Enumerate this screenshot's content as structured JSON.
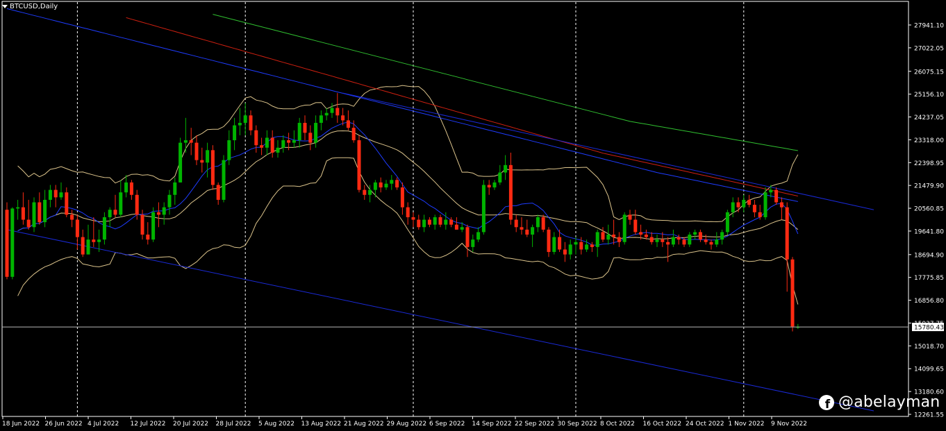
{
  "header": {
    "symbol_label": "BTCUSD,Daily"
  },
  "watermark": {
    "handle": "@abelayman",
    "icon": "facebook-icon"
  },
  "colors": {
    "background": "#000000",
    "frame": "#ffffff",
    "candle_up": "#00b400",
    "candle_down": "#ff2a12",
    "ma_fast": "#1e3cff",
    "ma_slow_red": "#d02010",
    "ma_slow_green": "#30c030",
    "band": "#dcc48c",
    "trendline": "#1a2ad8",
    "price_line": "#b8b8b8"
  },
  "chart_data": {
    "type": "candlestick",
    "y_ticks": [
      "27941.10",
      "27022.05",
      "26075.15",
      "25156.10",
      "24237.05",
      "23318.00",
      "22398.95",
      "21479.90",
      "20560.85",
      "19641.80",
      "18694.90",
      "17775.85",
      "16856.80",
      "15937.75",
      "15018.70",
      "14099.65",
      "13180.60",
      "12261.55"
    ],
    "ylim": [
      12261.55,
      28700
    ],
    "current_price": "15780.43",
    "x_labels": [
      "18 Jun 2022",
      "26 Jun 2022",
      "4 Jul 2022",
      "12 Jul 2022",
      "20 Jul 2022",
      "28 Jul 2022",
      "5 Aug 2022",
      "13 Aug 2022",
      "21 Aug 2022",
      "29 Aug 2022",
      "6 Sep 2022",
      "14 Sep 2022",
      "22 Sep 2022",
      "30 Sep 2022",
      "8 Oct 2022",
      "16 Oct 2022",
      "24 Oct 2022",
      "1 Nov 2022",
      "9 Nov 2022"
    ],
    "day_count": 147,
    "separator_days": [
      13,
      44,
      75,
      105,
      136
    ],
    "candles": [
      {
        "o": 20500,
        "h": 20800,
        "l": 17700,
        "c": 17800
      },
      {
        "o": 17800,
        "h": 20600,
        "l": 17700,
        "c": 20550
      },
      {
        "o": 20550,
        "h": 20900,
        "l": 20100,
        "c": 20600
      },
      {
        "o": 20600,
        "h": 21200,
        "l": 19900,
        "c": 20100
      },
      {
        "o": 20100,
        "h": 20900,
        "l": 19700,
        "c": 19800
      },
      {
        "o": 19800,
        "h": 21000,
        "l": 19600,
        "c": 20800
      },
      {
        "o": 20800,
        "h": 21200,
        "l": 19900,
        "c": 20000
      },
      {
        "o": 20000,
        "h": 21300,
        "l": 19800,
        "c": 20900
      },
      {
        "o": 20900,
        "h": 21500,
        "l": 20600,
        "c": 21300
      },
      {
        "o": 21300,
        "h": 21500,
        "l": 20600,
        "c": 21000
      },
      {
        "o": 21000,
        "h": 21600,
        "l": 20900,
        "c": 21200
      },
      {
        "o": 21200,
        "h": 21400,
        "l": 20200,
        "c": 20300
      },
      {
        "o": 20300,
        "h": 20500,
        "l": 19800,
        "c": 20100
      },
      {
        "o": 20100,
        "h": 20300,
        "l": 18900,
        "c": 19400
      },
      {
        "o": 19400,
        "h": 19700,
        "l": 18600,
        "c": 18700
      },
      {
        "o": 18700,
        "h": 19900,
        "l": 18700,
        "c": 19300
      },
      {
        "o": 19300,
        "h": 20200,
        "l": 19000,
        "c": 19200
      },
      {
        "o": 19200,
        "h": 19700,
        "l": 18800,
        "c": 19300
      },
      {
        "o": 19300,
        "h": 20400,
        "l": 19100,
        "c": 20200
      },
      {
        "o": 20200,
        "h": 20600,
        "l": 19800,
        "c": 20500
      },
      {
        "o": 20500,
        "h": 21100,
        "l": 20200,
        "c": 20300
      },
      {
        "o": 20300,
        "h": 21700,
        "l": 20200,
        "c": 21200
      },
      {
        "o": 21200,
        "h": 21900,
        "l": 21000,
        "c": 21600
      },
      {
        "o": 21600,
        "h": 21700,
        "l": 20900,
        "c": 21100
      },
      {
        "o": 21100,
        "h": 21300,
        "l": 20100,
        "c": 20300
      },
      {
        "o": 20300,
        "h": 20500,
        "l": 19300,
        "c": 19500
      },
      {
        "o": 19500,
        "h": 20000,
        "l": 19100,
        "c": 19300
      },
      {
        "o": 19300,
        "h": 20600,
        "l": 19200,
        "c": 20400
      },
      {
        "o": 20400,
        "h": 20800,
        "l": 19800,
        "c": 20300
      },
      {
        "o": 20300,
        "h": 20800,
        "l": 19900,
        "c": 20600
      },
      {
        "o": 20600,
        "h": 21300,
        "l": 20300,
        "c": 21100
      },
      {
        "o": 21100,
        "h": 21800,
        "l": 20700,
        "c": 21600
      },
      {
        "o": 21600,
        "h": 23400,
        "l": 21600,
        "c": 23200
      },
      {
        "o": 23200,
        "h": 24200,
        "l": 22800,
        "c": 23300
      },
      {
        "o": 23300,
        "h": 23800,
        "l": 22700,
        "c": 23200
      },
      {
        "o": 23200,
        "h": 23500,
        "l": 22300,
        "c": 22500
      },
      {
        "o": 22500,
        "h": 23000,
        "l": 22000,
        "c": 22400
      },
      {
        "o": 22400,
        "h": 23200,
        "l": 21800,
        "c": 22900
      },
      {
        "o": 22900,
        "h": 23100,
        "l": 21300,
        "c": 21500
      },
      {
        "o": 21500,
        "h": 21600,
        "l": 20700,
        "c": 20900
      },
      {
        "o": 20900,
        "h": 22700,
        "l": 20800,
        "c": 22500
      },
      {
        "o": 22500,
        "h": 23700,
        "l": 22300,
        "c": 23300
      },
      {
        "o": 23300,
        "h": 24200,
        "l": 22900,
        "c": 23900
      },
      {
        "o": 23900,
        "h": 24600,
        "l": 23500,
        "c": 24000
      },
      {
        "o": 24000,
        "h": 24800,
        "l": 23500,
        "c": 24300
      },
      {
        "o": 24300,
        "h": 24500,
        "l": 23500,
        "c": 23700
      },
      {
        "o": 23700,
        "h": 23900,
        "l": 22800,
        "c": 23100
      },
      {
        "o": 23100,
        "h": 23400,
        "l": 22700,
        "c": 23000
      },
      {
        "o": 23000,
        "h": 23700,
        "l": 22700,
        "c": 23400
      },
      {
        "o": 23400,
        "h": 23700,
        "l": 22600,
        "c": 22800
      },
      {
        "o": 22800,
        "h": 23300,
        "l": 22600,
        "c": 23000
      },
      {
        "o": 23000,
        "h": 23500,
        "l": 22800,
        "c": 23300
      },
      {
        "o": 23300,
        "h": 23600,
        "l": 22900,
        "c": 23200
      },
      {
        "o": 23200,
        "h": 23700,
        "l": 23000,
        "c": 23300
      },
      {
        "o": 23300,
        "h": 24200,
        "l": 23000,
        "c": 24000
      },
      {
        "o": 24000,
        "h": 24300,
        "l": 23300,
        "c": 23600
      },
      {
        "o": 23600,
        "h": 23900,
        "l": 22900,
        "c": 23200
      },
      {
        "o": 23200,
        "h": 24300,
        "l": 23000,
        "c": 24000
      },
      {
        "o": 24000,
        "h": 24500,
        "l": 23700,
        "c": 24300
      },
      {
        "o": 24300,
        "h": 24600,
        "l": 24100,
        "c": 24400
      },
      {
        "o": 24400,
        "h": 24800,
        "l": 24200,
        "c": 24600
      },
      {
        "o": 24600,
        "h": 25200,
        "l": 24000,
        "c": 24300
      },
      {
        "o": 24300,
        "h": 24600,
        "l": 23900,
        "c": 24100
      },
      {
        "o": 24100,
        "h": 24500,
        "l": 23700,
        "c": 23800
      },
      {
        "o": 23800,
        "h": 24100,
        "l": 23200,
        "c": 23300
      },
      {
        "o": 23300,
        "h": 23500,
        "l": 21200,
        "c": 21300
      },
      {
        "o": 21300,
        "h": 21500,
        "l": 20900,
        "c": 21100
      },
      {
        "o": 21100,
        "h": 21500,
        "l": 20800,
        "c": 21300
      },
      {
        "o": 21300,
        "h": 21700,
        "l": 21000,
        "c": 21600
      },
      {
        "o": 21600,
        "h": 21800,
        "l": 21200,
        "c": 21400
      },
      {
        "o": 21400,
        "h": 21700,
        "l": 21300,
        "c": 21550
      },
      {
        "o": 21550,
        "h": 21900,
        "l": 21300,
        "c": 21700
      },
      {
        "o": 21700,
        "h": 21800,
        "l": 21300,
        "c": 21400
      },
      {
        "o": 21400,
        "h": 21600,
        "l": 20300,
        "c": 20600
      },
      {
        "o": 20600,
        "h": 20800,
        "l": 19900,
        "c": 20200
      },
      {
        "o": 20200,
        "h": 20400,
        "l": 19800,
        "c": 20100
      },
      {
        "o": 20100,
        "h": 20300,
        "l": 19700,
        "c": 19800
      },
      {
        "o": 19800,
        "h": 20300,
        "l": 19600,
        "c": 20100
      },
      {
        "o": 20100,
        "h": 20200,
        "l": 19800,
        "c": 19900
      },
      {
        "o": 19900,
        "h": 20300,
        "l": 19700,
        "c": 20200
      },
      {
        "o": 20200,
        "h": 20300,
        "l": 19800,
        "c": 19900
      },
      {
        "o": 19900,
        "h": 20400,
        "l": 19700,
        "c": 20100
      },
      {
        "o": 20100,
        "h": 20200,
        "l": 19800,
        "c": 19900
      },
      {
        "o": 19900,
        "h": 20200,
        "l": 19700,
        "c": 19700
      },
      {
        "o": 19700,
        "h": 20000,
        "l": 19600,
        "c": 19800
      },
      {
        "o": 19800,
        "h": 19900,
        "l": 18600,
        "c": 19000
      },
      {
        "o": 19000,
        "h": 19500,
        "l": 18800,
        "c": 19300
      },
      {
        "o": 19300,
        "h": 19800,
        "l": 19200,
        "c": 19600
      },
      {
        "o": 19600,
        "h": 21700,
        "l": 19500,
        "c": 21500
      },
      {
        "o": 21500,
        "h": 21700,
        "l": 21100,
        "c": 21400
      },
      {
        "o": 21400,
        "h": 21700,
        "l": 21300,
        "c": 21600
      },
      {
        "o": 21600,
        "h": 22300,
        "l": 21500,
        "c": 22000
      },
      {
        "o": 22000,
        "h": 22700,
        "l": 21700,
        "c": 22300
      },
      {
        "o": 22300,
        "h": 22800,
        "l": 19900,
        "c": 20100
      },
      {
        "o": 20100,
        "h": 20300,
        "l": 19600,
        "c": 19800
      },
      {
        "o": 19800,
        "h": 20200,
        "l": 19500,
        "c": 19700
      },
      {
        "o": 19700,
        "h": 20100,
        "l": 19400,
        "c": 19500
      },
      {
        "o": 19500,
        "h": 19900,
        "l": 19000,
        "c": 19800
      },
      {
        "o": 19800,
        "h": 20300,
        "l": 19600,
        "c": 20200
      },
      {
        "o": 20200,
        "h": 20300,
        "l": 19600,
        "c": 19700
      },
      {
        "o": 19700,
        "h": 19800,
        "l": 18600,
        "c": 18800
      },
      {
        "o": 18800,
        "h": 19600,
        "l": 18700,
        "c": 19400
      },
      {
        "o": 19400,
        "h": 19700,
        "l": 18800,
        "c": 18900
      },
      {
        "o": 18900,
        "h": 19200,
        "l": 18400,
        "c": 18700
      },
      {
        "o": 18700,
        "h": 19300,
        "l": 18500,
        "c": 19100
      },
      {
        "o": 19100,
        "h": 19400,
        "l": 18700,
        "c": 19200
      },
      {
        "o": 19200,
        "h": 19400,
        "l": 18700,
        "c": 18900
      },
      {
        "o": 18900,
        "h": 19300,
        "l": 18800,
        "c": 19100
      },
      {
        "o": 19100,
        "h": 19200,
        "l": 18800,
        "c": 19000
      },
      {
        "o": 19000,
        "h": 19700,
        "l": 18600,
        "c": 19600
      },
      {
        "o": 19600,
        "h": 19800,
        "l": 19200,
        "c": 19300
      },
      {
        "o": 19300,
        "h": 19900,
        "l": 19100,
        "c": 19500
      },
      {
        "o": 19500,
        "h": 20100,
        "l": 19100,
        "c": 19400
      },
      {
        "o": 19400,
        "h": 19600,
        "l": 19000,
        "c": 19200
      },
      {
        "o": 19200,
        "h": 20400,
        "l": 19100,
        "c": 20300
      },
      {
        "o": 20300,
        "h": 20500,
        "l": 19900,
        "c": 20100
      },
      {
        "o": 20100,
        "h": 20500,
        "l": 19500,
        "c": 19600
      },
      {
        "o": 19600,
        "h": 19900,
        "l": 19300,
        "c": 19500
      },
      {
        "o": 19500,
        "h": 19700,
        "l": 19300,
        "c": 19400
      },
      {
        "o": 19400,
        "h": 19600,
        "l": 19100,
        "c": 19200
      },
      {
        "o": 19200,
        "h": 19500,
        "l": 19000,
        "c": 19300
      },
      {
        "o": 19300,
        "h": 19600,
        "l": 19000,
        "c": 19200
      },
      {
        "o": 19200,
        "h": 19400,
        "l": 18400,
        "c": 19100
      },
      {
        "o": 19100,
        "h": 19700,
        "l": 19000,
        "c": 19400
      },
      {
        "o": 19400,
        "h": 19500,
        "l": 19100,
        "c": 19300
      },
      {
        "o": 19300,
        "h": 19400,
        "l": 19000,
        "c": 19100
      },
      {
        "o": 19100,
        "h": 19600,
        "l": 19000,
        "c": 19500
      },
      {
        "o": 19500,
        "h": 19700,
        "l": 19300,
        "c": 19600
      },
      {
        "o": 19600,
        "h": 19700,
        "l": 19200,
        "c": 19300
      },
      {
        "o": 19300,
        "h": 19500,
        "l": 19100,
        "c": 19200
      },
      {
        "o": 19200,
        "h": 19300,
        "l": 18900,
        "c": 19100
      },
      {
        "o": 19100,
        "h": 19600,
        "l": 19000,
        "c": 19300
      },
      {
        "o": 19300,
        "h": 19700,
        "l": 19100,
        "c": 19600
      },
      {
        "o": 19600,
        "h": 20500,
        "l": 19500,
        "c": 20400
      },
      {
        "o": 20400,
        "h": 21000,
        "l": 20200,
        "c": 20800
      },
      {
        "o": 20800,
        "h": 21000,
        "l": 20400,
        "c": 20600
      },
      {
        "o": 20600,
        "h": 21100,
        "l": 20400,
        "c": 20900
      },
      {
        "o": 20900,
        "h": 21100,
        "l": 20600,
        "c": 20700
      },
      {
        "o": 20700,
        "h": 20900,
        "l": 20200,
        "c": 20400
      },
      {
        "o": 20400,
        "h": 20700,
        "l": 20100,
        "c": 20200
      },
      {
        "o": 20200,
        "h": 21400,
        "l": 20100,
        "c": 21200
      },
      {
        "o": 21200,
        "h": 21500,
        "l": 21000,
        "c": 21300
      },
      {
        "o": 21300,
        "h": 21400,
        "l": 20700,
        "c": 20800
      },
      {
        "o": 20800,
        "h": 21000,
        "l": 20100,
        "c": 20600
      },
      {
        "o": 20600,
        "h": 20800,
        "l": 17200,
        "c": 18500
      },
      {
        "o": 18500,
        "h": 18600,
        "l": 15600,
        "c": 15800
      },
      {
        "o": 15750,
        "h": 15900,
        "l": 15700,
        "c": 15780
      }
    ],
    "trendlines": [
      {
        "d1": 62,
        "p1": 25200,
        "d2": 160,
        "p2": 20500
      },
      {
        "d1": 0,
        "p1": 19700,
        "d2": 160,
        "p2": 12400
      }
    ]
  }
}
